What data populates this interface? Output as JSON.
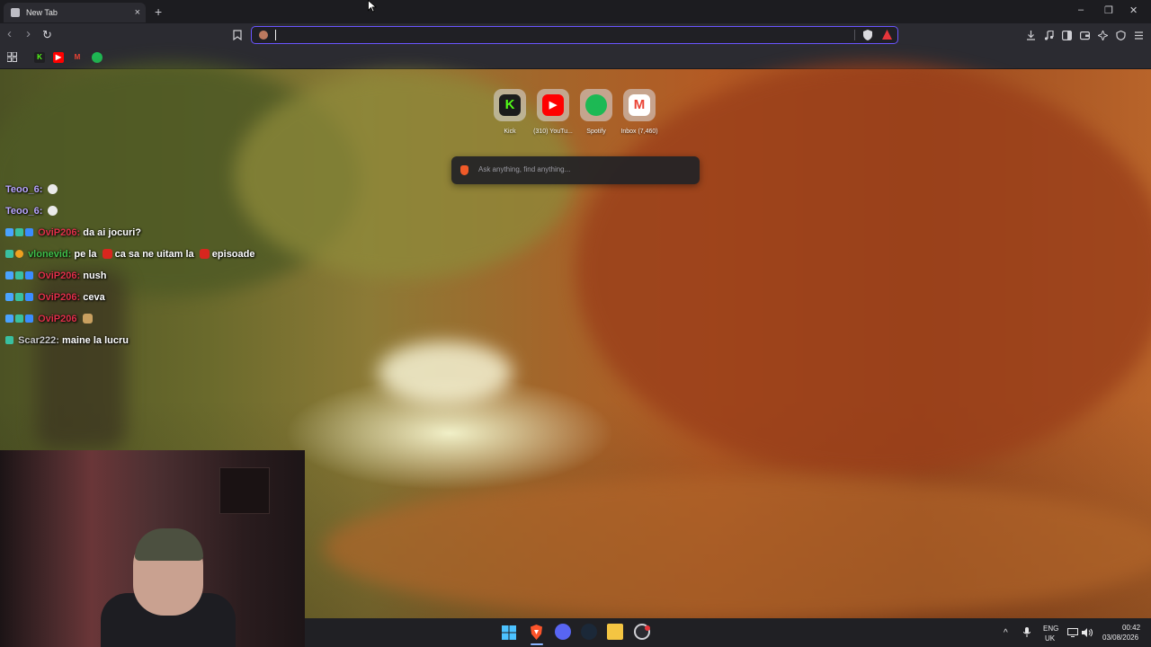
{
  "browser": {
    "tab": {
      "title": "New Tab",
      "close_glyph": "×"
    },
    "new_tab_glyph": "+",
    "window_controls": {
      "minimize": "–",
      "maximize": "❐",
      "close": "✕"
    },
    "nav": {
      "back": "‹",
      "forward": "›",
      "reload": "↻"
    },
    "address_bar": {
      "value": "",
      "placeholder": ""
    },
    "accent_color": "#6a55ff",
    "bookmarks": [
      {
        "name": "Kick",
        "letter": "K",
        "color": "#53fc18"
      },
      {
        "name": "YouTube",
        "letter": "▶",
        "color": "#ff0000"
      },
      {
        "name": "Gmail",
        "letter": "M",
        "color": "#ea4335"
      },
      {
        "name": "Spotify",
        "letter": "●",
        "color": "#1db954"
      }
    ]
  },
  "new_tab_page": {
    "shortcuts": [
      {
        "label": "Kick",
        "glyph": "K",
        "color": "#53fc18",
        "icon": "kick-icon"
      },
      {
        "label": "(310) YouTu...",
        "glyph": "▶",
        "color": "#ff0000",
        "icon": "youtube-icon"
      },
      {
        "label": "Spotify",
        "glyph": "●",
        "color": "#1db954",
        "icon": "spotify-icon"
      },
      {
        "label": "Inbox (7,460)",
        "glyph": "M",
        "color": "#ea4335",
        "icon": "gmail-icon"
      }
    ],
    "search_placeholder": "Ask anything, find anything..."
  },
  "chat": [
    {
      "user": "Teoo_6:",
      "user_color": "#b9a6ff",
      "message": ""
    },
    {
      "user": "Teoo_6:",
      "user_color": "#b9a6ff",
      "message": ""
    },
    {
      "user": "OviP206:",
      "user_color": "#e0304a",
      "message": "da ai jocuri?"
    },
    {
      "user": "vlonevid:",
      "user_color": "#3fbf4a",
      "message": "pe la",
      "mid": "ca sa ne uitam la",
      "end": "episoade"
    },
    {
      "user": "OviP206:",
      "user_color": "#e0304a",
      "message": "nush"
    },
    {
      "user": "OviP206:",
      "user_color": "#e0304a",
      "message": "ceva"
    },
    {
      "user": "OviP206",
      "user_color": "#e0304a",
      "message": ""
    },
    {
      "user": "Scar222:",
      "user_color": "#c8c8c8",
      "message": "maine la lucru"
    }
  ],
  "taskbar": {
    "apps": [
      "windows-start",
      "brave",
      "discord",
      "steam",
      "file-explorer",
      "chrome-notify"
    ],
    "tray": {
      "lang_top": "ENG",
      "lang_bottom": "UK",
      "time": "00:42",
      "date": "03/08/2026",
      "chevron": "^"
    }
  }
}
